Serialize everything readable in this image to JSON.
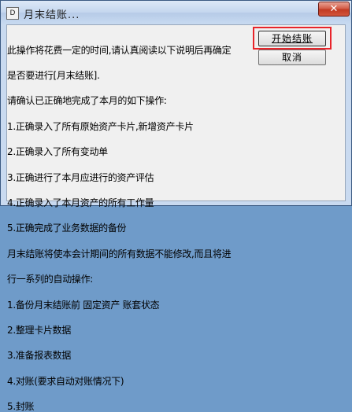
{
  "window": {
    "icon": "app-document-icon",
    "title": "月末结账...",
    "close_glyph": "✕"
  },
  "buttons": {
    "start_label": "开始结账",
    "cancel_label": "取消"
  },
  "message_lines": [
    "此操作将花费一定的时间,请认真阅读以下说明后再确定",
    "是否要进行[月末结账].",
    "请确认已正确地完成了本月的如下操作:",
    "1.正确录入了所有原始资产卡片,新增资产卡片",
    "2.正确录入了所有变动单",
    "3.正确进行了本月应进行的资产评估",
    "4.正确录入了本月资产的所有工作量",
    "5.正确完成了业务数据的备份",
    "月末结账将使本会计期间的所有数据不能修改,而且将进",
    "行一系列的自动操作:",
    "1.备份月末结账前 固定资产 账套状态",
    "2.整理卡片数据",
    "3.准备报表数据",
    "4.对账(要求自动对账情况下)",
    "5.封账"
  ]
}
